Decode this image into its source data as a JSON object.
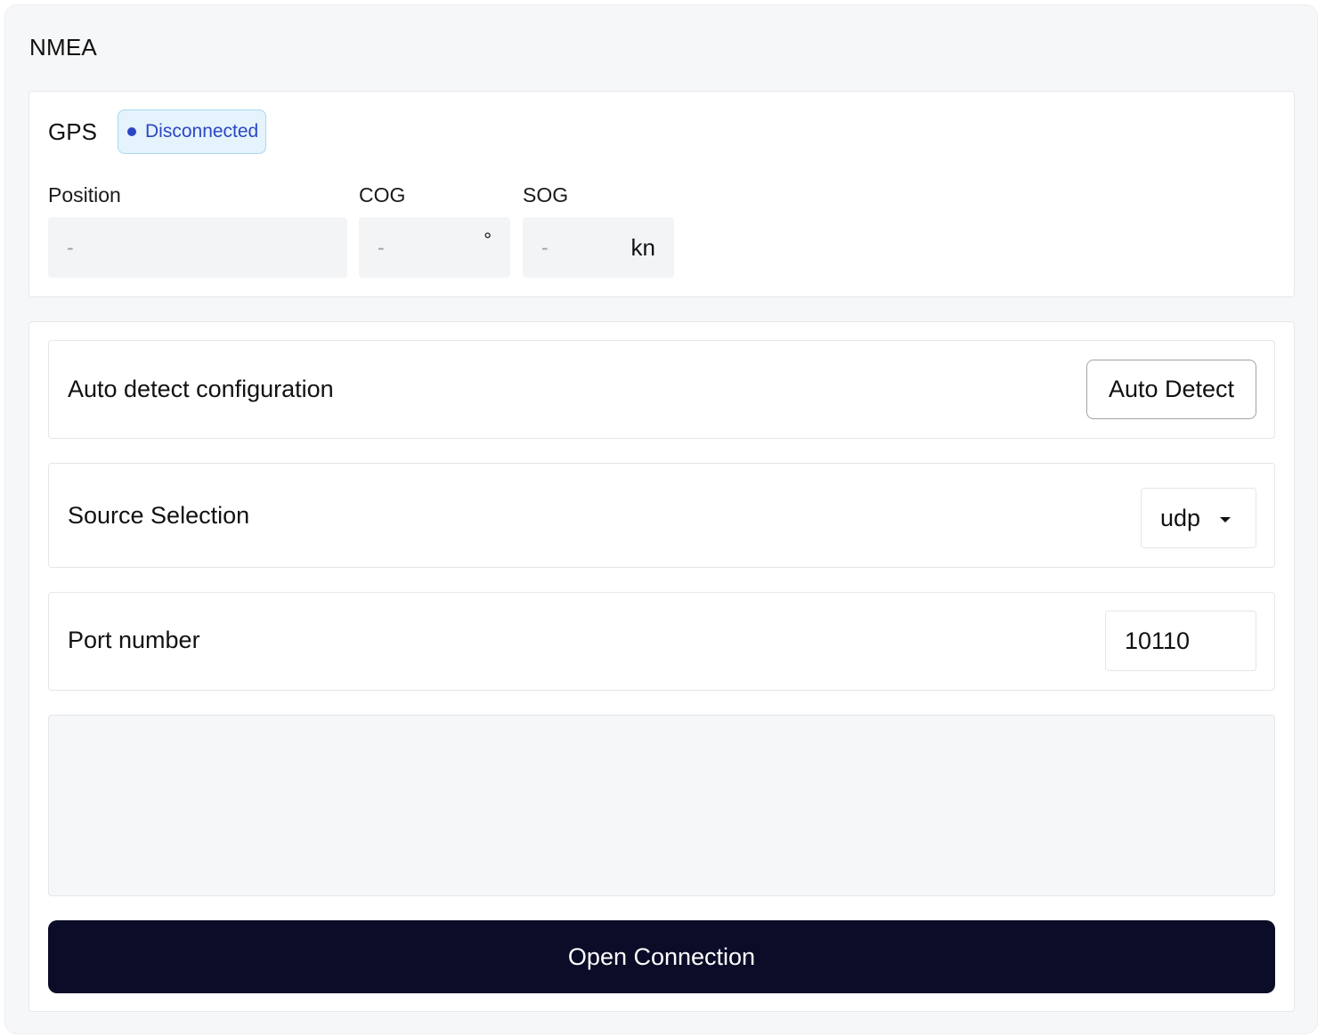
{
  "panel": {
    "title": "NMEA"
  },
  "gps": {
    "title": "GPS",
    "status": {
      "label": "Disconnected",
      "color": "#2b46c4",
      "icon": "dot-icon"
    },
    "fields": {
      "position": {
        "label": "Position",
        "value": "-",
        "unit": ""
      },
      "cog": {
        "label": "COG",
        "value": "-",
        "unit": "°"
      },
      "sog": {
        "label": "SOG",
        "value": "-",
        "unit": "kn"
      }
    }
  },
  "config": {
    "auto_detect": {
      "label": "Auto detect configuration",
      "button": "Auto Detect"
    },
    "source": {
      "label": "Source Selection",
      "selected": "udp",
      "icon": "caret-down-icon"
    },
    "port": {
      "label": "Port number",
      "value": "10110"
    }
  },
  "actions": {
    "open_connection": "Open Connection",
    "button_color": "#0b0c27"
  }
}
